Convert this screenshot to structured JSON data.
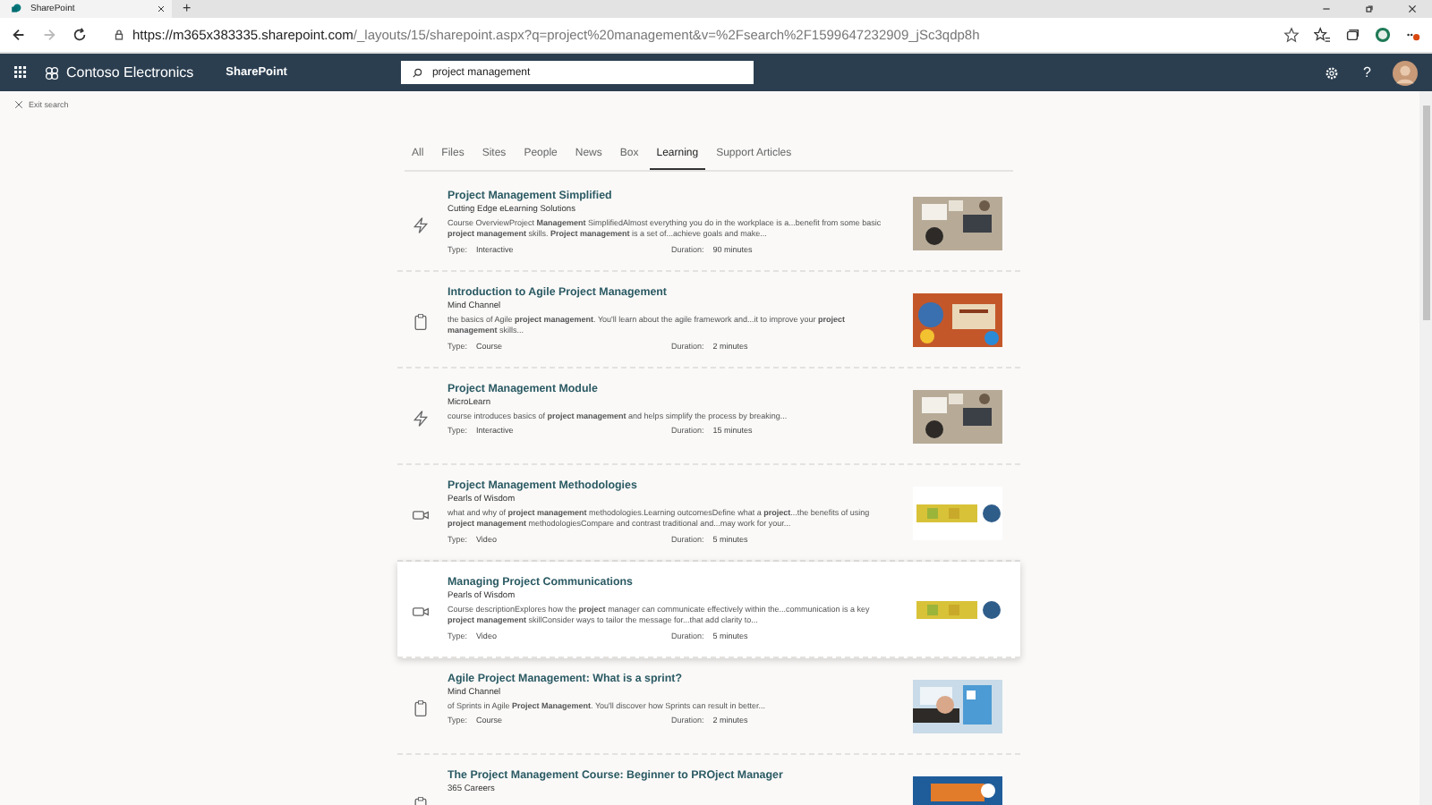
{
  "browser": {
    "tab_title": "SharePoint",
    "new_tab": "+",
    "url_host": "https://m365x383335.sharepoint.com",
    "url_path": "/_layouts/15/sharepoint.aspx?q=project%20management&v=%2Fsearch%2F1599647232909_jSc3qdp8h"
  },
  "suite_bar": {
    "org": "Contoso Electronics",
    "app": "SharePoint",
    "search_value": "project management",
    "help": "?"
  },
  "exit_search": "Exit search",
  "tabs": [
    {
      "label": "All",
      "selected": false
    },
    {
      "label": "Files",
      "selected": false
    },
    {
      "label": "Sites",
      "selected": false
    },
    {
      "label": "People",
      "selected": false
    },
    {
      "label": "News",
      "selected": false
    },
    {
      "label": "Box",
      "selected": false
    },
    {
      "label": "Learning",
      "selected": true
    },
    {
      "label": "Support Articles",
      "selected": false
    }
  ],
  "results": [
    {
      "kind": "interactive",
      "title": "Project Management Simplified",
      "source": "Cutting Edge eLearning Solutions",
      "description": "Course OverviewProject **Management** SimplifiedAlmost everything you do in the workplace is a...benefit from some basic **project management** skills. **Project management** is a set of...achieve goals and make...",
      "type_label": "Type:",
      "type": "Interactive",
      "duration_label": "Duration:",
      "duration": "90 minutes",
      "hovered": false
    },
    {
      "kind": "course",
      "title": "Introduction to Agile Project Management",
      "source": "Mind Channel",
      "description": "the basics of Agile **project management**. You'll learn about the agile framework and...it to improve your **project management** skills...",
      "type_label": "Type:",
      "type": "Course",
      "duration_label": "Duration:",
      "duration": "2 minutes",
      "hovered": false
    },
    {
      "kind": "interactive",
      "title": "Project Management Module",
      "source": "MicroLearn",
      "description": "course introduces basics of **project management** and helps simplify the process by breaking...",
      "type_label": "Type:",
      "type": "Interactive",
      "duration_label": "Duration:",
      "duration": "15 minutes",
      "hovered": false
    },
    {
      "kind": "video",
      "title": "Project Management Methodologies",
      "source": "Pearls of Wisdom",
      "description": "what and why of **project management** methodologies.Learning outcomesDefine what a **project**...the benefits of using **project management** methodologiesCompare and contrast traditional and...may work for your...",
      "type_label": "Type:",
      "type": "Video",
      "duration_label": "Duration:",
      "duration": "5 minutes",
      "hovered": false
    },
    {
      "kind": "video",
      "title": "Managing Project Communications",
      "source": "Pearls of Wisdom",
      "description": "Course descriptionExplores how the **project** manager can communicate effectively within the...communication is a key **project management** skillConsider ways to tailor the message for...that add clarity to...",
      "type_label": "Type:",
      "type": "Video",
      "duration_label": "Duration:",
      "duration": "5 minutes",
      "hovered": true
    },
    {
      "kind": "course",
      "title": "Agile Project Management: What is a sprint?",
      "source": "Mind Channel",
      "description": "of Sprints in Agile **Project Management**. You'll discover how Sprints can result in better...",
      "type_label": "Type:",
      "type": "Course",
      "duration_label": "Duration:",
      "duration": "2 minutes",
      "hovered": false
    },
    {
      "kind": "course",
      "title": "The Project Management Course: Beginner to PROject Manager",
      "source": "365 Careers",
      "hovered": false
    }
  ]
}
